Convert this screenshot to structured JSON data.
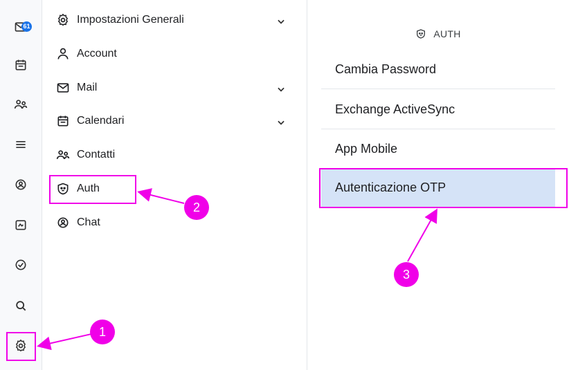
{
  "rail": {
    "mail_badge": "61",
    "icons": [
      "mail-icon",
      "calendar-icon",
      "contacts-icon",
      "list-icon",
      "chat-icon",
      "files-icon",
      "tasks-icon",
      "search-icon",
      "settings-icon"
    ]
  },
  "menu": {
    "items": [
      {
        "label": "Impostazioni Generali",
        "icon": "gear-icon",
        "expandable": true
      },
      {
        "label": "Account",
        "icon": "user-icon",
        "expandable": false
      },
      {
        "label": "Mail",
        "icon": "mail-icon",
        "expandable": true
      },
      {
        "label": "Calendari",
        "icon": "calendar-icon",
        "expandable": true
      },
      {
        "label": "Contatti",
        "icon": "contacts-icon",
        "expandable": false
      },
      {
        "label": "Auth",
        "icon": "shield-icon",
        "expandable": false
      },
      {
        "label": "Chat",
        "icon": "chat-icon",
        "expandable": false
      }
    ]
  },
  "panel": {
    "header": "AUTH",
    "options": [
      "Cambia Password",
      "Exchange ActiveSync",
      "App Mobile",
      "Autenticazione OTP"
    ],
    "selected": "Autenticazione OTP"
  },
  "annotations": {
    "color": "#f000e8",
    "markers": [
      "1",
      "2",
      "3"
    ]
  }
}
